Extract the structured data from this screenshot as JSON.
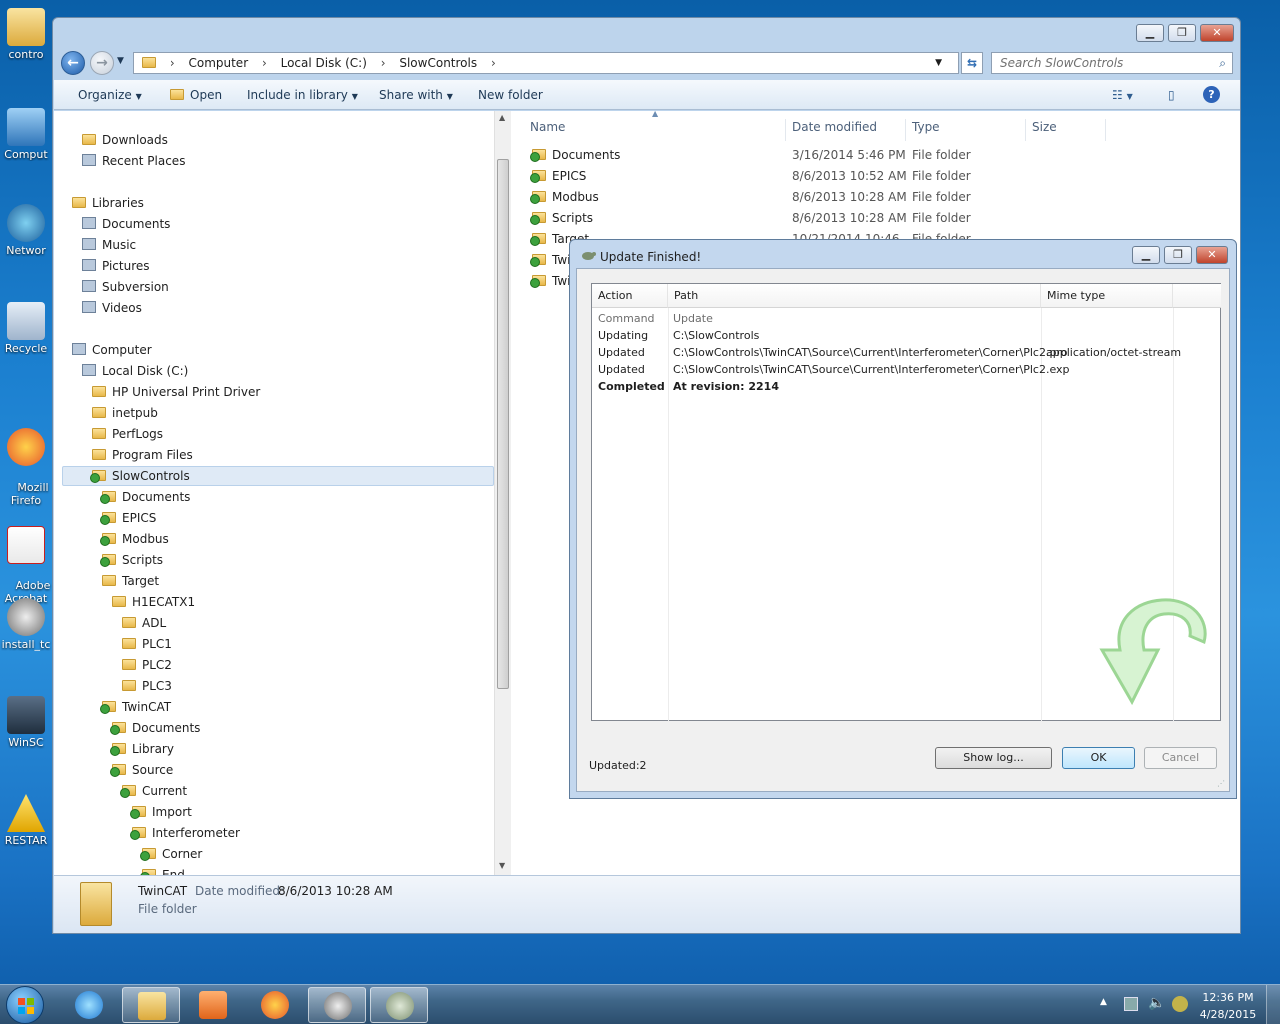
{
  "desktop": {
    "icons": [
      {
        "label": "contro"
      },
      {
        "label": "Comput"
      },
      {
        "label": "Networ"
      },
      {
        "label": "Recycle"
      },
      {
        "label": "Mozill\nFirefo"
      },
      {
        "label": "Adobe\nAcrobat"
      },
      {
        "label": "install_tc"
      },
      {
        "label": "WinSC"
      },
      {
        "label": "RESTAR"
      }
    ]
  },
  "explorer": {
    "breadcrumb": [
      "Computer",
      "Local Disk (C:)",
      "SlowControls"
    ],
    "search_placeholder": "Search SlowControls",
    "toolbar": {
      "organize": "Organize",
      "open": "Open",
      "include_in_library": "Include in library",
      "share_with": "Share with",
      "new_folder": "New folder"
    },
    "tree": [
      {
        "label": "Downloads",
        "indent": 1,
        "icon": "folder"
      },
      {
        "label": "Recent Places",
        "indent": 1,
        "icon": "gear"
      },
      {
        "label": "Libraries",
        "indent": 0,
        "icon": "folder"
      },
      {
        "label": "Documents",
        "indent": 1,
        "icon": "doc"
      },
      {
        "label": "Music",
        "indent": 1,
        "icon": "music"
      },
      {
        "label": "Pictures",
        "indent": 1,
        "icon": "pic"
      },
      {
        "label": "Subversion",
        "indent": 1,
        "icon": "doc"
      },
      {
        "label": "Videos",
        "indent": 1,
        "icon": "video"
      },
      {
        "label": "Computer",
        "indent": 0,
        "icon": "computer"
      },
      {
        "label": "Local Disk (C:)",
        "indent": 1,
        "icon": "drive"
      },
      {
        "label": "HP Universal Print Driver",
        "indent": 2,
        "icon": "folder"
      },
      {
        "label": "inetpub",
        "indent": 2,
        "icon": "folder"
      },
      {
        "label": "PerfLogs",
        "indent": 2,
        "icon": "folder"
      },
      {
        "label": "Program Files",
        "indent": 2,
        "icon": "folder"
      },
      {
        "label": "SlowControls",
        "indent": 2,
        "icon": "svn",
        "selected": true
      },
      {
        "label": "Documents",
        "indent": 3,
        "icon": "svn"
      },
      {
        "label": "EPICS",
        "indent": 3,
        "icon": "svn"
      },
      {
        "label": "Modbus",
        "indent": 3,
        "icon": "svn"
      },
      {
        "label": "Scripts",
        "indent": 3,
        "icon": "svn"
      },
      {
        "label": "Target",
        "indent": 3,
        "icon": "folder"
      },
      {
        "label": "H1ECATX1",
        "indent": 4,
        "icon": "folder"
      },
      {
        "label": "ADL",
        "indent": 5,
        "icon": "folder"
      },
      {
        "label": "PLC1",
        "indent": 5,
        "icon": "folder"
      },
      {
        "label": "PLC2",
        "indent": 5,
        "icon": "folder"
      },
      {
        "label": "PLC3",
        "indent": 5,
        "icon": "folder"
      },
      {
        "label": "TwinCAT",
        "indent": 3,
        "icon": "svn"
      },
      {
        "label": "Documents",
        "indent": 4,
        "icon": "svn"
      },
      {
        "label": "Library",
        "indent": 4,
        "icon": "svn"
      },
      {
        "label": "Source",
        "indent": 4,
        "icon": "svn"
      },
      {
        "label": "Current",
        "indent": 5,
        "icon": "svn"
      },
      {
        "label": "Import",
        "indent": 6,
        "icon": "svn"
      },
      {
        "label": "Interferometer",
        "indent": 6,
        "icon": "svn"
      },
      {
        "label": "Corner",
        "indent": 7,
        "icon": "svn"
      },
      {
        "label": "End",
        "indent": 7,
        "icon": "svn"
      }
    ],
    "columns": [
      "Name",
      "Date modified",
      "Type",
      "Size"
    ],
    "files": [
      {
        "name": "Documents",
        "date": "3/16/2014 5:46 PM",
        "type": "File folder"
      },
      {
        "name": "EPICS",
        "date": "8/6/2013 10:52 AM",
        "type": "File folder"
      },
      {
        "name": "Modbus",
        "date": "8/6/2013 10:28 AM",
        "type": "File folder"
      },
      {
        "name": "Scripts",
        "date": "8/6/2013 10:28 AM",
        "type": "File folder"
      },
      {
        "name": "Target",
        "date": "10/21/2014 10:46",
        "type": "File folder"
      },
      {
        "name": "Twi",
        "date": "",
        "type": ""
      },
      {
        "name": "Twi",
        "date": "",
        "type": ""
      }
    ],
    "details": {
      "name": "TwinCAT",
      "date_label": "Date modified:",
      "date_value": "8/6/2013 10:28 AM",
      "type": "File folder"
    }
  },
  "dialog": {
    "title": "Update Finished!",
    "columns": [
      "Action",
      "Path",
      "Mime type"
    ],
    "rows": [
      {
        "action": "Command",
        "path": "Update",
        "mime": "",
        "style": "head"
      },
      {
        "action": "Updating",
        "path": "C:\\SlowControls",
        "mime": "",
        "style": "normal"
      },
      {
        "action": "Updated",
        "path": "C:\\SlowControls\\TwinCAT\\Source\\Current\\Interferometer\\Corner\\Plc2.pro",
        "mime": "application/octet-stream",
        "style": "normal"
      },
      {
        "action": "Updated",
        "path": "C:\\SlowControls\\TwinCAT\\Source\\Current\\Interferometer\\Corner\\Plc2.exp",
        "mime": "",
        "style": "normal"
      },
      {
        "action": "Completed",
        "path": "At revision: 2214",
        "mime": "",
        "style": "bold"
      }
    ],
    "status": "Updated:2",
    "show_log": "Show log...",
    "ok": "OK",
    "cancel": "Cancel"
  },
  "taskbar": {
    "time": "12:36 PM",
    "date": "4/28/2015"
  },
  "colors": {
    "accent": "#3399ff",
    "folder": "#e8b84a",
    "svn_ok": "#3da13d"
  }
}
